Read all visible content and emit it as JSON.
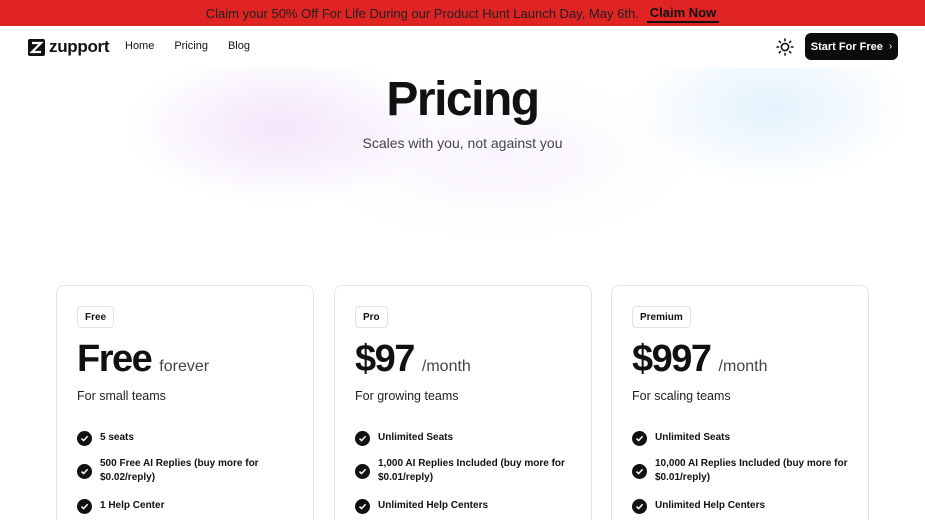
{
  "promo": {
    "text": "Claim your 50% Off For Life During our Product Hunt Launch Day, May 6th.",
    "cta": "Claim Now"
  },
  "header": {
    "logo_text": "zupport",
    "nav": [
      "Home",
      "Pricing",
      "Blog"
    ],
    "cta": "Start For Free",
    "theme_icon": "sun-icon"
  },
  "hero": {
    "title": "Pricing",
    "subtitle": "Scales with you, not against you"
  },
  "plans": [
    {
      "tier": "Free",
      "price": "Free",
      "period": "forever",
      "audience": "For small teams",
      "features": [
        "5 seats",
        "500 Free AI Replies (buy more for $0.02/reply)",
        "1 Help Center"
      ]
    },
    {
      "tier": "Pro",
      "price": "$97",
      "period": "/month",
      "audience": "For growing teams",
      "features": [
        "Unlimited Seats",
        "1,000 AI Replies Included (buy more for $0.01/reply)",
        "Unlimited Help Centers"
      ]
    },
    {
      "tier": "Premium",
      "price": "$997",
      "period": "/month",
      "audience": "For scaling teams",
      "features": [
        "Unlimited Seats",
        "10,000 AI Replies Included (buy more for $0.01/reply)",
        "Unlimited Help Centers"
      ]
    }
  ],
  "colors": {
    "banner": "#e02424",
    "primary": "#0c0c0c"
  }
}
